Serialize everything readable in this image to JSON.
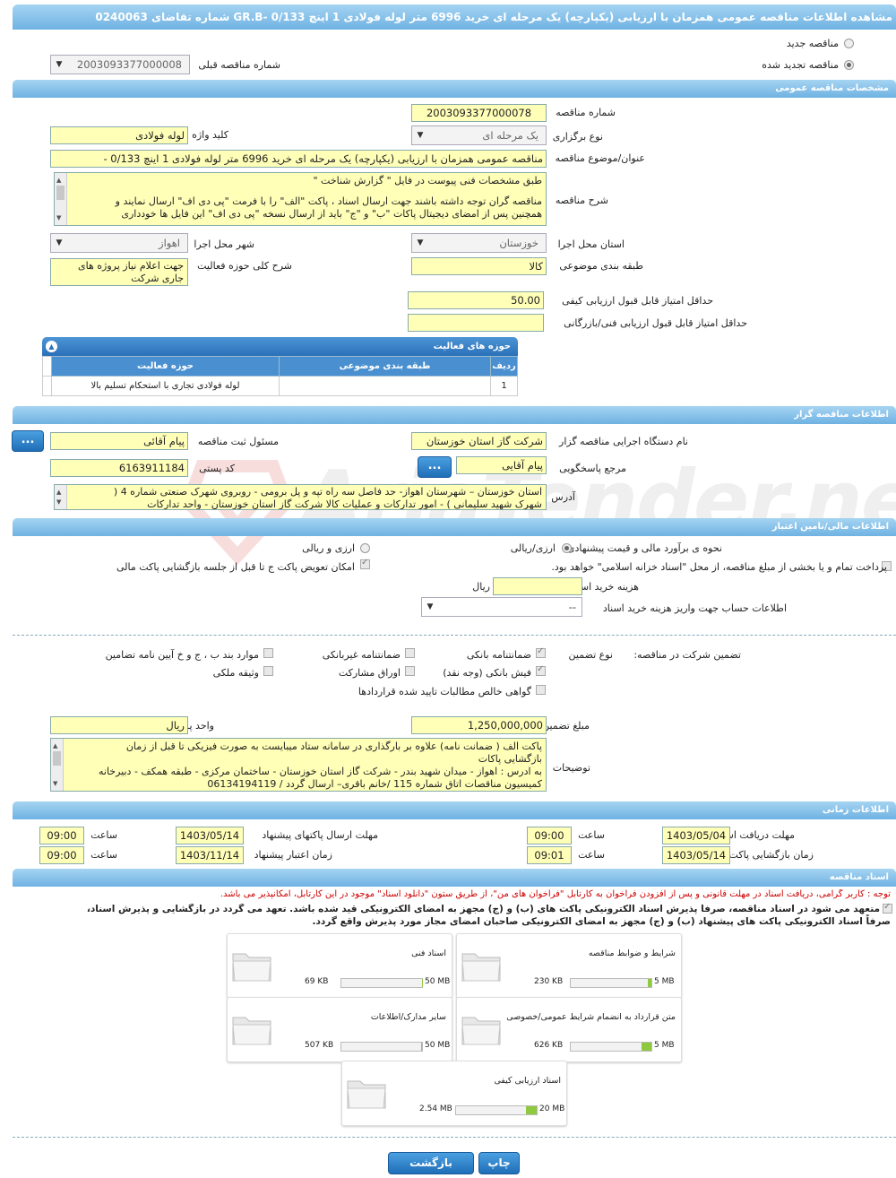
{
  "header": {
    "title": "مشاهده اطلاعات مناقصه عمومی همزمان با ارزیابی (یکپارچه) یک مرحله ای خرید 6996 متر لوله فولادی 1 اینچ GR.B- 0/133 شماره تقاضای 0240063"
  },
  "top": {
    "new_tender": "مناقصه جدید",
    "renewed_tender": "مناقصه تجدید شده",
    "prev_number_label": "شماره مناقصه قبلی",
    "prev_number_value": "2003093377000008"
  },
  "general": {
    "section": "مشخصات مناقصه عمومی",
    "number_label": "شماره مناقصه",
    "number_value": "2003093377000078",
    "type_label": "نوع برگزاری",
    "type_value": "یک مرحله ای",
    "keyword_label": "کلید واژه",
    "keyword_value": "لوله فولادی",
    "subject_label": "عنوان/موضوع مناقصه",
    "subject_value": "مناقصه عمومی همزمان با ارزیابی (یکپارچه) یک مرحله ای خرید 6996 متر لوله فولادی 1 اینچ 0/133 -",
    "desc_label": "شرح مناقصه",
    "desc_line1": "طبق مشخصات فنی پیوست در فایل  \" گزارش شناخت \"",
    "desc_line2": "مناقصه گران توجه داشته باشند جهت ارسال اسناد ، پاکت \"الف\" را با فرمت  \"پی دی اف\"  ارسال نمایند و",
    "desc_line3": "همچنین پس از امضای دیجیتال پاکات  \"ب\" و \"ج\" باید از ارسال نسخه \"پی دی اف\"  این فایل ها خودداری",
    "province_label": "استان محل اجرا",
    "province_value": "خوزستان",
    "city_label": "شهر محل اجرا",
    "city_value": "اهواز",
    "category_label": "طبقه بندی موضوعی",
    "category_value": "کالا",
    "activity_label": "شرح کلی حوزه فعالیت",
    "activity_value1": "جهت اعلام نیاز پروژه های",
    "activity_value2": "جاری شرکت",
    "min_quality_label": "حداقل امتیاز قابل قبول ارزیابی کیفی",
    "min_quality_value": "50.00",
    "min_tech_label": "حداقل امتیاز قابل قبول ارزیابی فنی/بازرگانی",
    "min_tech_value": ""
  },
  "activities": {
    "title": "حوزه های فعالیت",
    "col_row": "ردیف",
    "col_cat": "طبقه بندی موضوعی",
    "col_field": "حوزه فعالیت",
    "rows": [
      {
        "row": "1",
        "cat": "",
        "field": "لوله فولادی تجاری با استحکام تسلیم بالا"
      }
    ]
  },
  "org": {
    "section": "اطلاعات مناقصه گزار",
    "exec_label": "نام دستگاه اجرایی مناقصه گزار",
    "exec_value": "شرکت گاز استان خوزستان",
    "reg_label": "مسئول ثبت مناقصه",
    "reg_value": "پیام  آقائی",
    "ref_label": "مرجع پاسخگویی",
    "ref_value": "پیام آقایی",
    "postal_label": "کد پستی",
    "postal_value": "6163911184",
    "address_label": "آدرس",
    "address_line1": "استان خوزستان – شهرستان اهواز- حد فاصل سه راه تپه  و پل برومی - روبروی شهرک صنعتی شماره 4 (",
    "address_line2": "شهرک شهید سلیمانی  ) - امور تدارکات و عملیات کالا شرکت گاز استان خوزستان - واحد تدارکات",
    "dots": "..."
  },
  "finance": {
    "section": "اطلاعات مالی/تامین اعتبار",
    "estimate_label": "نحوه ی برآورد مالی و قیمت پیشنهادی",
    "opt_rial_fx": "ارزی/ریالی",
    "opt_fx_rial": "ارزی و ریالی",
    "pay_label": "پرداخت تمام و یا بخشی از مبلغ مناقصه، از محل \"اسناد خزانه اسلامی\" خواهد بود.",
    "swap_label": "امکان تعویض پاکت ج تا قبل از جلسه بازگشایی پاکت مالی",
    "doc_fee_label": "هزینه خرید اسناد",
    "doc_fee_value": "",
    "rial": "ریال",
    "account_label": "اطلاعات حساب جهت واریز هزینه خرید اسناد",
    "account_value": "--"
  },
  "guarantee": {
    "participation_label": "تضمین شرکت در مناقصه:",
    "type_label": "نوع تضمین",
    "opts": [
      "ضمانتنامه بانکی",
      "ضمانتنامه غیربانکی",
      "موارد بند ب ، ج و خ آیین نامه تضامین",
      "فیش بانکی (وجه نقد)",
      "اوراق مشارکت",
      "وثیقه ملکی",
      "گواهی خالص مطالبات تایید شده قراردادها"
    ],
    "amount_label": "مبلغ تضمین",
    "amount_value": "1,250,000,000",
    "currency_label": "واحد پول",
    "currency_value": "ریال",
    "notes_label": "توضیحات",
    "notes_line1": "پاکت الف ( ضمانت نامه) علاوه بر بارگذاری در سامانه ستاد میبایست به صورت فیزیکی تا قبل از زمان",
    "notes_line2": "بازگشایی پاکات",
    "notes_line3": "به ادرس : اهواز - میدان شهید بندر - شرکت گاز استان خوزستان - ساختمان مرکزی - طبقه همکف - دبیرخانه",
    "notes_line4": "کمیسیون مناقصات  اتاق شماره 115 /خانم باقری– ارسال گردد / 06134194119"
  },
  "timing": {
    "section": "اطلاعات زمانی",
    "receive_label": "مهلت دریافت اسناد",
    "receive_date": "1403/05/04",
    "receive_time": "09:00",
    "send_label": "مهلت ارسال پاکتهای پیشنهاد",
    "send_date": "1403/05/14",
    "send_time": "09:00",
    "open_label": "زمان بازگشایی پاکت ها",
    "open_date": "1403/05/14",
    "open_time": "09:01",
    "valid_label": "زمان اعتبار پیشنهاد",
    "valid_date": "1403/11/14",
    "valid_time": "09:00",
    "time_label": "ساعت"
  },
  "docs": {
    "section": "اسناد مناقصه",
    "note": "توجه : کاربر گرامی، دریافت اسناد در مهلت قانونی و پس از افزودن فراخوان به کارتابل \"فراخوان های من\"، از طریق ستون \"دانلود اسناد\" موجود در این کارتابل، امکانپذیر می باشد.",
    "commit1": "متعهد می شود در اسناد مناقصه، صرفاً پذیرش اسناد الکترونیکی پاکت های (ب) و (ج) مجهز به امضای الکترونیکی قید شده باشد. تعهد می گردد در بازگشایی و پذیرش اسناد،",
    "commit2": "صرفاً اسناد الکترونیکی پاکت های پیشنهاد (ب) و (ج) مجهز به امضای الکترونیکی صاحبان امضای مجاز مورد پذیرش واقع گردد.",
    "files": [
      {
        "title": "شرایط و ضوابط مناقصه",
        "max": "5 MB",
        "size": "230 KB",
        "pct": 4.5
      },
      {
        "title": "اسناد فنی",
        "max": "50 MB",
        "size": "69 KB",
        "pct": 0.5
      },
      {
        "title": "متن قرارداد به انضمام شرایط عمومی/خصوصی",
        "max": "5 MB",
        "size": "626 KB",
        "pct": 12
      },
      {
        "title": "سایر مدارک/اطلاعات",
        "max": "50 MB",
        "size": "507 KB",
        "pct": 1.5
      },
      {
        "title": "اسناد ارزیابی کیفی",
        "max": "20 MB",
        "size": "2.54 MB",
        "pct": 13
      }
    ]
  },
  "footer": {
    "print": "چاپ",
    "back": "بازگشت"
  },
  "watermark": "AriaTender.neT"
}
